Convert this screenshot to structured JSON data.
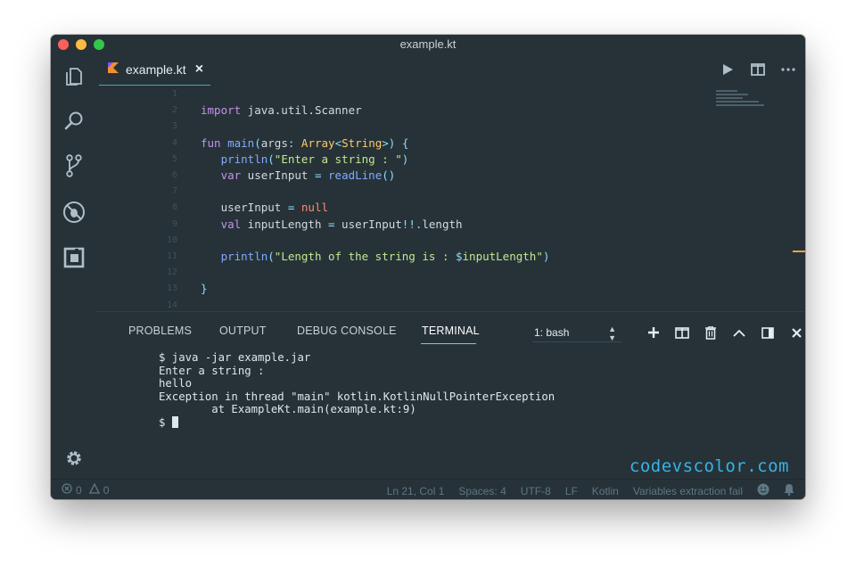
{
  "window": {
    "title": "example.kt"
  },
  "tab": {
    "label": "example.kt",
    "close": "×"
  },
  "editor": {
    "line_numbers": [
      "1",
      "2",
      "3",
      "4",
      "5",
      "6",
      "7",
      "8",
      "9",
      "10",
      "11",
      "12",
      "13",
      "14"
    ]
  },
  "panel": {
    "tabs": [
      "PROBLEMS",
      "OUTPUT",
      "DEBUG CONSOLE",
      "TERMINAL"
    ],
    "terminal_select": "1: bash",
    "terminal_lines": [
      "$ java -jar example.jar",
      "Enter a string :",
      "hello",
      "Exception in thread \"main\" kotlin.KotlinNullPointerException",
      "        at ExampleKt.main(example.kt:9)"
    ],
    "prompt": "$ "
  },
  "watermark": "codevscolor.com",
  "status": {
    "errors": "0",
    "warnings": "0",
    "position": "Ln 21, Col 1",
    "spaces": "Spaces: 4",
    "encoding": "UTF-8",
    "eol": "LF",
    "language": "Kotlin",
    "message": "Variables extraction fail"
  },
  "colors": {
    "background": "#263238",
    "accent": "#80cbc4",
    "keyword": "#c792ea",
    "string": "#c3e88d",
    "type": "#ffcb6b",
    "watermark": "#36b3e5"
  },
  "icons": [
    "files-icon",
    "search-icon",
    "source-control-icon",
    "debug-icon",
    "extensions-icon",
    "gear-icon",
    "run-icon",
    "split-editor-icon",
    "more-icon",
    "add-terminal-icon",
    "split-terminal-icon",
    "trash-icon",
    "maximize-panel-icon",
    "panel-layout-icon",
    "close-panel-icon",
    "error-icon",
    "warning-icon",
    "smiley-icon",
    "bell-icon"
  ]
}
